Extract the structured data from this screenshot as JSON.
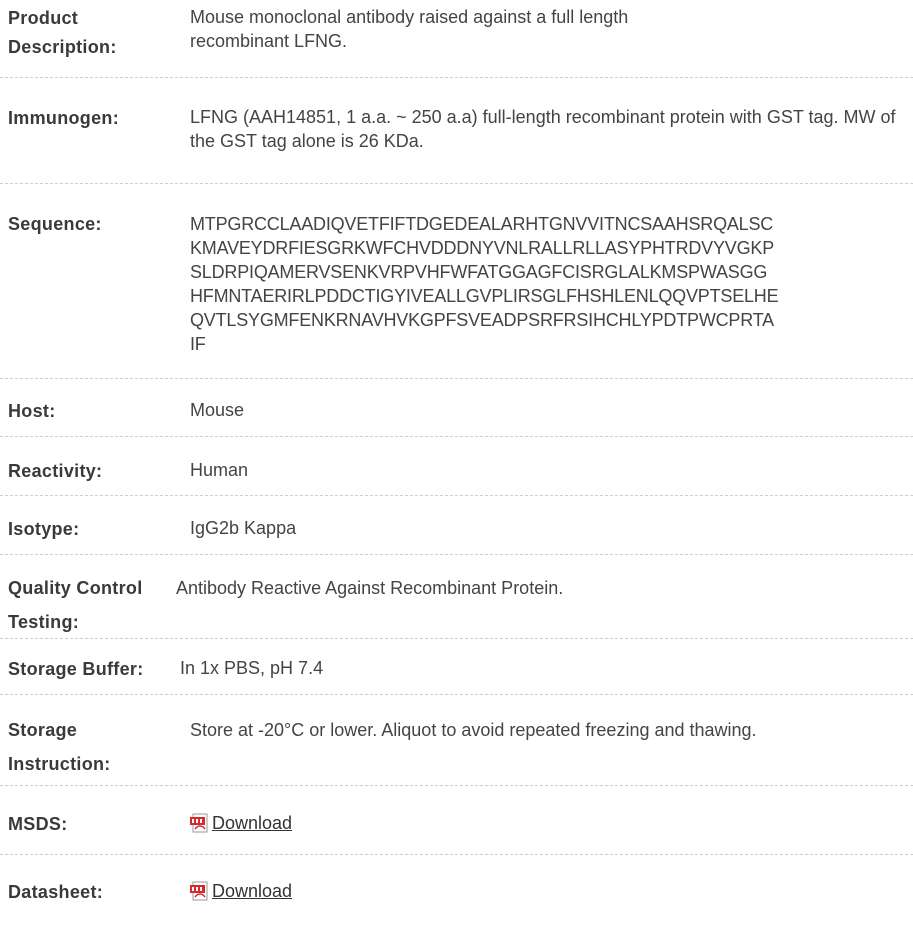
{
  "rows": {
    "product_description": {
      "label": "Product Description:",
      "value": "Mouse monoclonal antibody raised against a full length recombinant LFNG."
    },
    "immunogen": {
      "label": "Immunogen:",
      "value": "LFNG (AAH14851, 1 a.a. ~ 250 a.a) full-length recombinant protein with GST tag. MW of the GST tag alone is 26 KDa."
    },
    "sequence": {
      "label": "Sequence:",
      "lines": [
        "MTPGRCCLAADIQVETFIFTDGEDEALARHTGNVVITNCSAAHSRQALSC",
        "KMAVEYDRFIESGRKWFCHVDDDNYVNLRALLRLLASYPHTRDVYVGKP",
        "SLDRPIQAMERVSENKVRPVHFWFATGGAGFCISRGLALKMSPWASGG",
        "HFMNTAERIRLPDDCTIGYIVEALLGVPLIRSGLFHSHLENLQQVPTSELHE",
        "QVTLSYGMFENKRNAVHVKGPFSVEADPSRFRSIHCHLYPDTPWCPRTA",
        "IF"
      ]
    },
    "host": {
      "label": "Host:",
      "value": "Mouse"
    },
    "reactivity": {
      "label": "Reactivity:",
      "value": "Human"
    },
    "isotype": {
      "label": "Isotype:",
      "value": "IgG2b Kappa"
    },
    "quality_control": {
      "label": "Quality Control Testing:",
      "value": "Antibody Reactive Against Recombinant Protein."
    },
    "storage_buffer": {
      "label": "Storage Buffer:",
      "value": "In 1x PBS, pH 7.4"
    },
    "storage_instruction": {
      "label": "Storage Instruction:",
      "value": "Store at -20°C or lower. Aliquot to avoid repeated freezing and thawing."
    },
    "msds": {
      "label": "MSDS:",
      "link_text": "Download",
      "icon": "pdf-icon"
    },
    "datasheet": {
      "label": "Datasheet:",
      "link_text": "Download",
      "icon": "pdf-icon"
    }
  },
  "colors": {
    "label": "#3a3a3a",
    "text": "#444444",
    "divider": "#cfcfcf",
    "pdf_red": "#d8282b"
  }
}
